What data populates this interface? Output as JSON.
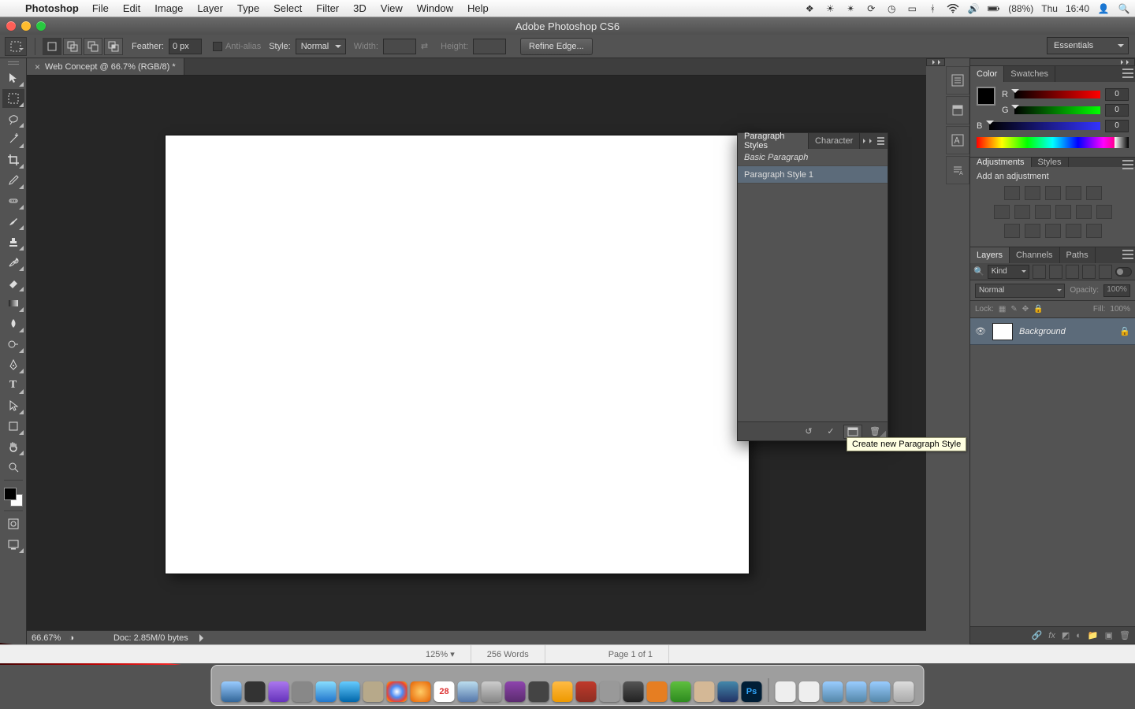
{
  "menubar": {
    "app": "Photoshop",
    "items": [
      "File",
      "Edit",
      "Image",
      "Layer",
      "Type",
      "Select",
      "Filter",
      "3D",
      "View",
      "Window",
      "Help"
    ],
    "battery": "(88%)",
    "day": "Thu",
    "time": "16:40"
  },
  "window": {
    "title": "Adobe Photoshop CS6"
  },
  "options": {
    "feather_label": "Feather:",
    "feather_value": "0 px",
    "antialias_label": "Anti-alias",
    "style_label": "Style:",
    "style_value": "Normal",
    "width_label": "Width:",
    "height_label": "Height:",
    "refine_label": "Refine Edge...",
    "workspace": "Essentials"
  },
  "document": {
    "tab_title": "Web Concept @ 66.7% (RGB/8) *",
    "zoom": "66.67%",
    "doc_info": "Doc: 2.85M/0 bytes"
  },
  "paragraph_panel": {
    "tab1": "Paragraph Styles",
    "tab2": "Character",
    "items": [
      "Basic Paragraph",
      "Paragraph Style 1"
    ],
    "tooltip": "Create new Paragraph Style"
  },
  "panels": {
    "color_tabs": [
      "Color",
      "Swatches"
    ],
    "rgb": {
      "r": "0",
      "g": "0",
      "b": "0"
    },
    "adjust_tabs": [
      "Adjustments",
      "Styles"
    ],
    "adjust_title": "Add an adjustment",
    "layers_tabs": [
      "Layers",
      "Channels",
      "Paths"
    ],
    "layers": {
      "filter_kind": "Kind",
      "blend": "Normal",
      "opacity_label": "Opacity:",
      "opacity_value": "100%",
      "lock_label": "Lock:",
      "fill_label": "Fill:",
      "fill_value": "100%",
      "layer_name": "Background"
    }
  },
  "bgwin": {
    "zoom": "125%",
    "words": "256 Words",
    "page": "Page 1 of 1"
  }
}
